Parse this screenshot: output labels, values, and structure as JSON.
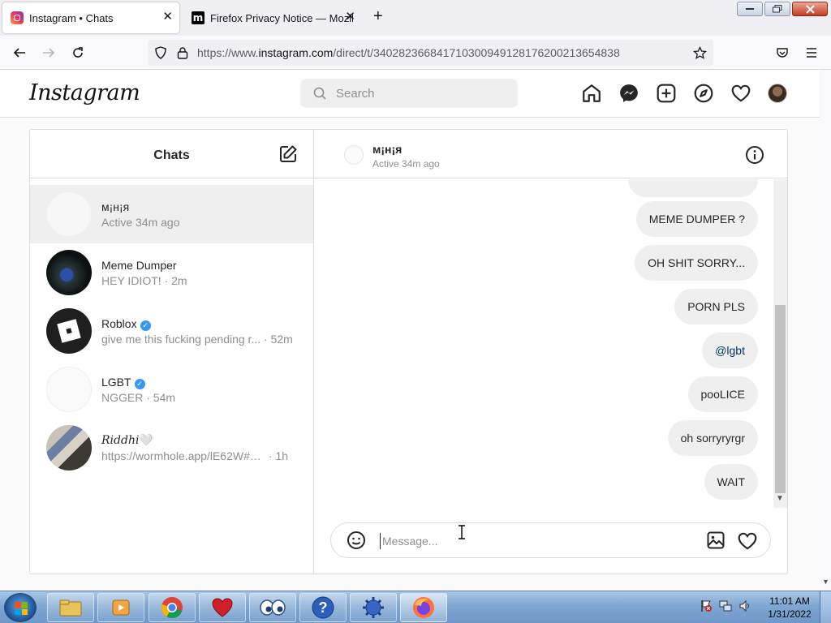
{
  "browser": {
    "tabs": [
      {
        "title": "Instagram • Chats",
        "favicon": "instagram-icon",
        "active": true
      },
      {
        "title": "Firefox Privacy Notice — Mozilla",
        "favicon": "mozilla-icon",
        "active": false
      }
    ],
    "new_tab_symbol": "+",
    "url_prefix": "https://www.",
    "url_domain": "instagram.com",
    "url_path": "/direct/t/340282366841710300949128176200213654838"
  },
  "instagram": {
    "logo": "Instagram",
    "search_placeholder": "Search",
    "nav_icons": [
      "home-icon",
      "messenger-icon",
      "new-post-icon",
      "explore-icon",
      "activity-heart-icon",
      "profile-avatar"
    ],
    "inbox": {
      "title": "Chats",
      "threads": [
        {
          "name": "м¡н¡я",
          "message": "Active 34m ago",
          "time": "",
          "verified": false,
          "selected": true
        },
        {
          "name": "Meme Dumper",
          "message": "HEY IDIOT!",
          "time": "· 2m",
          "verified": false,
          "selected": false
        },
        {
          "name": "Roblox",
          "message": "give me this fucking pending r...",
          "time": "· 52m",
          "verified": true,
          "selected": false
        },
        {
          "name": "LGBT",
          "message": "NGGER",
          "time": "· 54m",
          "verified": true,
          "selected": false
        },
        {
          "name": "𝑅𝑖𝑑𝑑ℎ𝑖🤍",
          "message": "https://wormhole.app/lE62W#HH...",
          "time": "· 1h",
          "verified": false,
          "selected": false
        }
      ]
    },
    "conversation": {
      "name": "м¡н¡я",
      "status": "Active 34m ago",
      "messages": [
        {
          "text": "MEME DUMPER ?",
          "link": false
        },
        {
          "text": "OH SHIT SORRY...",
          "link": false
        },
        {
          "text": "PORN PLS",
          "link": false
        },
        {
          "text": "@lgbt",
          "link": true
        },
        {
          "text": "pooLICE",
          "link": false
        },
        {
          "text": "oh sorryryrgr",
          "link": false
        },
        {
          "text": "WAIT",
          "link": false
        }
      ],
      "composer_placeholder": "Message..."
    }
  },
  "taskbar": {
    "apps": [
      "file-explorer-icon",
      "media-player-icon",
      "chrome-icon",
      "heart-app-icon",
      "eyes-app-icon",
      "help-icon",
      "virus-app-icon",
      "firefox-icon"
    ],
    "time": "11:01 AM",
    "date": "1/31/2022"
  },
  "colors": {
    "ig_border": "#dbdbdb",
    "bubble_bg": "#efefef",
    "verified_blue": "#3897f0",
    "link_blue": "#00376b"
  }
}
